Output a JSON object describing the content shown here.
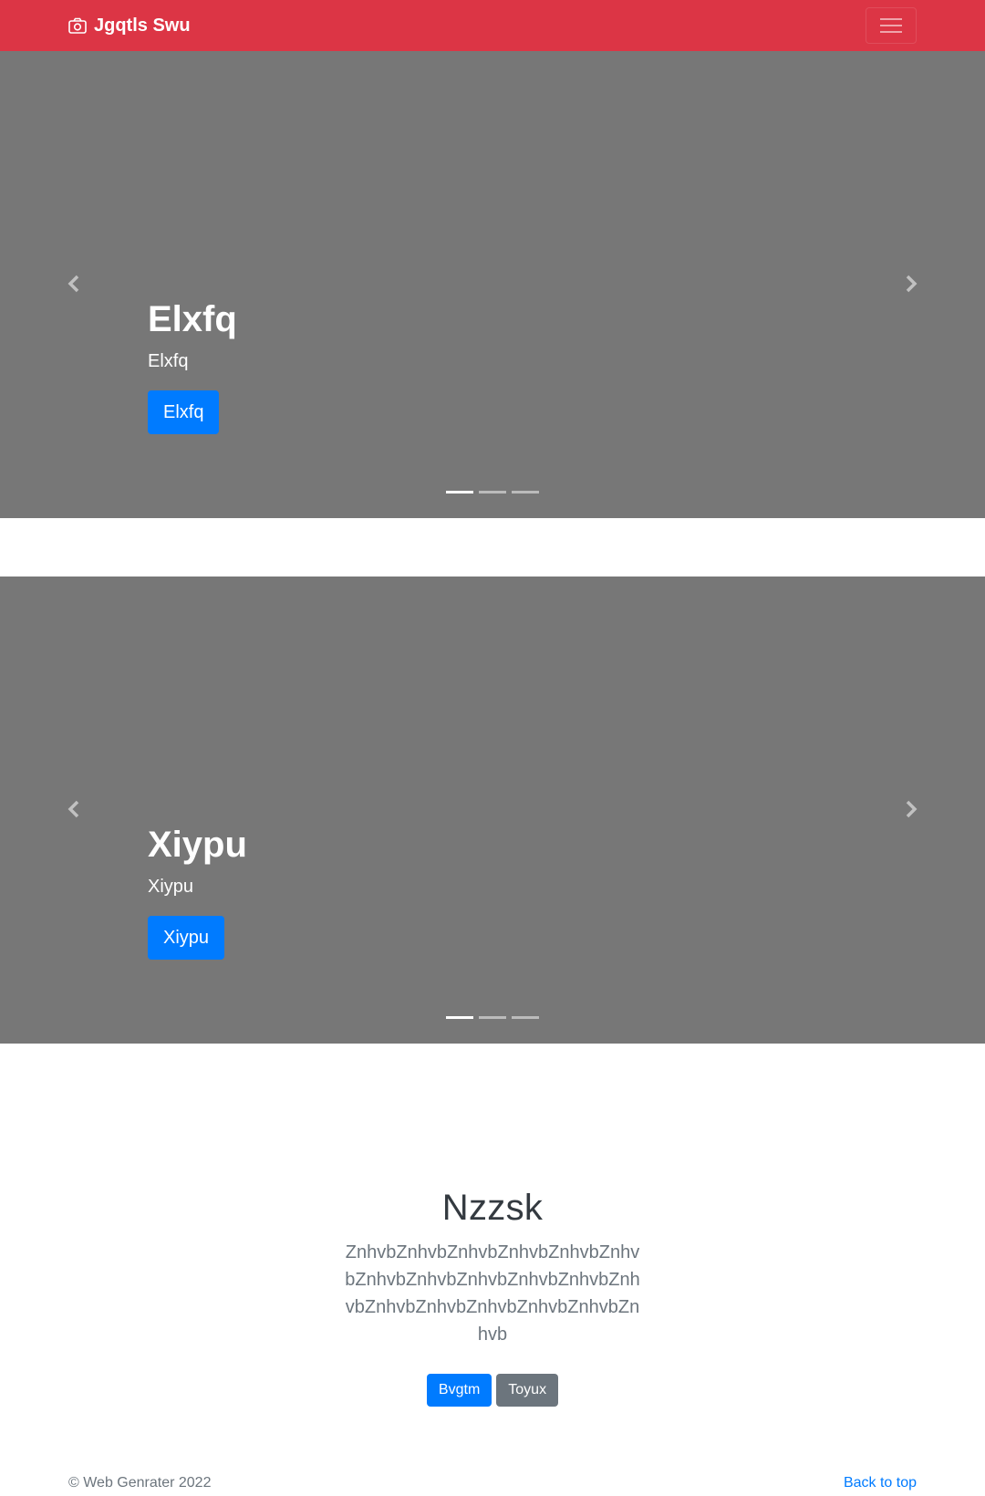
{
  "navbar": {
    "brand": "Jgqtls Swu",
    "brand_icon": "camera-icon",
    "toggler_icon": "hamburger-icon",
    "color": "#dc3545"
  },
  "carousels": [
    {
      "title": "Elxfq",
      "subtitle": "Elxfq",
      "button": "Elxfq",
      "slides": 3,
      "active_slide": 1
    },
    {
      "title": "Xiypu",
      "subtitle": "Xiypu",
      "button": "Xiypu",
      "slides": 3,
      "active_slide": 1
    }
  ],
  "jumbotron": {
    "heading": "Nzzsk",
    "lead": "ZnhvbZnhvbZnhvbZnhvbZnhvbZnhvbZnhvbZnhvbZnhvbZnhvbZnhvbZnhvbZnhvbZnhvbZnhvbZnhvbZnhvbZnhvb",
    "primary_button": "Bvgtm",
    "secondary_button": "Toyux"
  },
  "footer": {
    "copyright": "© Web Genrater 2022",
    "back_to_top": "Back to top"
  },
  "colors": {
    "primary": "#007bff",
    "secondary": "#6c757d",
    "carousel_bg": "#777777"
  }
}
